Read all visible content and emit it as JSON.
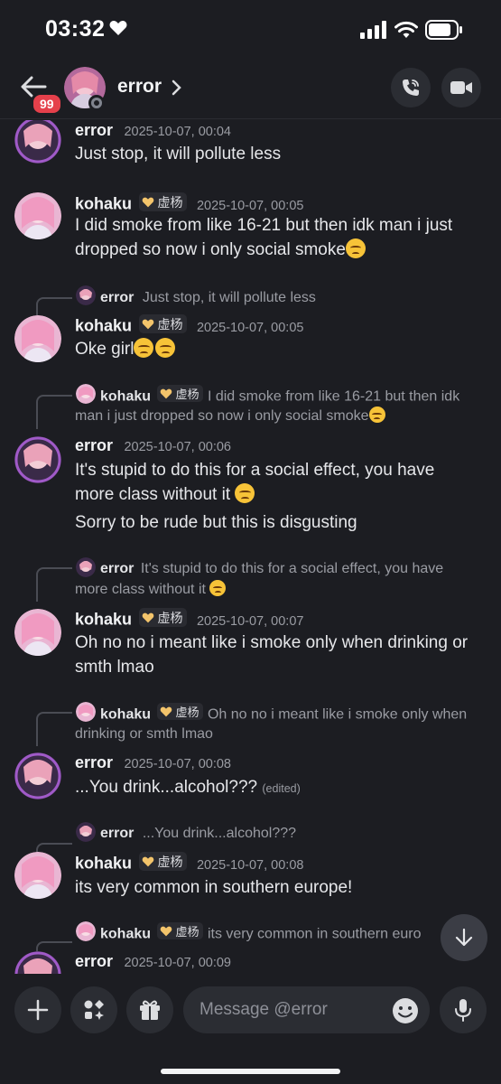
{
  "status_bar": {
    "time": "03:32"
  },
  "header": {
    "title": "error",
    "unread_badge": "99"
  },
  "messages": [
    {
      "username": "error",
      "timestamp": "2025-10-07, 00:04",
      "lines": [
        "Just stop, it will pollute less"
      ]
    },
    {
      "username": "kohaku",
      "tag": "虚杨",
      "timestamp": "2025-10-07, 00:05",
      "lines": [
        "I did smoke from like 16-21 but then idk man i just",
        "dropped so now i only social smoke"
      ]
    },
    {
      "reply_to": {
        "username": "error",
        "text": "Just stop, it will pollute less"
      },
      "username": "kohaku",
      "tag": "虚杨",
      "timestamp": "2025-10-07, 00:05",
      "lines": [
        "Oke girl"
      ]
    },
    {
      "reply_to": {
        "username": "kohaku",
        "tag": "虚杨",
        "text_line1": "I did smoke from like 16-21 but then idk",
        "text_line2": "man i just dropped so now i only social smoke"
      },
      "username": "error",
      "timestamp": "2025-10-07, 00:06",
      "lines": [
        "It's stupid to do this for a social effect, you have",
        "more class without it",
        "Sorry to be rude but this is disgusting"
      ]
    },
    {
      "reply_to": {
        "username": "error",
        "text_line1": "It's stupid to do this for a social effect, you have",
        "text_line2": "more class without it"
      },
      "username": "kohaku",
      "tag": "虚杨",
      "timestamp": "2025-10-07, 00:07",
      "lines": [
        "Oh no no i meant like i smoke only when drinking or",
        "smth lmao"
      ]
    },
    {
      "reply_to": {
        "username": "kohaku",
        "tag": "虚杨",
        "text_line1": "Oh no no i meant like i smoke only when",
        "text_line2": "drinking or smth lmao"
      },
      "username": "error",
      "timestamp": "2025-10-07, 00:08",
      "lines": [
        "...You drink...alcohol???"
      ],
      "edited": "(edited)"
    },
    {
      "reply_to": {
        "username": "error",
        "text": "...You drink...alcohol???"
      },
      "username": "kohaku",
      "tag": "虚杨",
      "timestamp": "2025-10-07, 00:08",
      "lines": [
        "its very common in southern europe!"
      ]
    },
    {
      "reply_to": {
        "username": "kohaku",
        "tag": "虚杨",
        "text": "its very common in southern euro"
      },
      "username": "error",
      "timestamp": "2025-10-07, 00:09"
    }
  ],
  "composer": {
    "placeholder": "Message @error"
  },
  "colors": {
    "background": "#1c1d22",
    "badge": "#e5404b",
    "button": "#2b2d33"
  }
}
